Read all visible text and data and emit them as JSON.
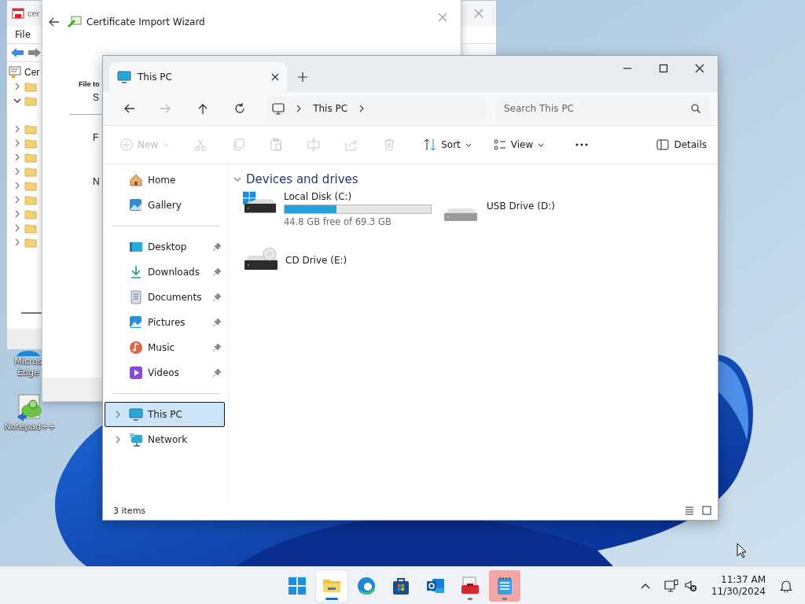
{
  "desktop_icons": [
    {
      "kind": "browser",
      "lines": [
        "Micros",
        "Edge"
      ]
    },
    {
      "kind": "notepad",
      "lines": [
        "Notepad++"
      ]
    }
  ],
  "cert_manager": {
    "title": "cer",
    "menu": [
      "File"
    ],
    "tree_root": "Cer",
    "tree": [
      {
        "expanded": false
      },
      {
        "expanded": true
      },
      {
        "expanded": false
      },
      {
        "expanded": false
      },
      {
        "expanded": false
      },
      {
        "expanded": false
      },
      {
        "expanded": false
      },
      {
        "expanded": false
      },
      {
        "expanded": false
      },
      {
        "expanded": false
      },
      {
        "expanded": false
      }
    ]
  },
  "wizard": {
    "title": "Certificate Import Wizard",
    "heading": "File to",
    "lines": [
      "S",
      "F",
      "N"
    ]
  },
  "explorer": {
    "tab": {
      "title": "This PC"
    },
    "address": {
      "crumbs": [
        "This PC"
      ]
    },
    "search": {
      "placeholder": "Search This PC"
    },
    "toolbar": [
      {
        "kind": "new",
        "label": "New",
        "disabled": true
      },
      {
        "kind": "cut",
        "disabled": true
      },
      {
        "kind": "copy",
        "disabled": true
      },
      {
        "kind": "paste",
        "disabled": true
      },
      {
        "kind": "rename",
        "disabled": true
      },
      {
        "kind": "share",
        "disabled": true
      },
      {
        "kind": "delete",
        "disabled": true
      },
      {
        "kind": "sort",
        "label": "Sort",
        "disabled": false
      },
      {
        "kind": "view",
        "label": "View",
        "disabled": false
      },
      {
        "kind": "more",
        "disabled": false
      }
    ],
    "details_button": "Details",
    "sidebar": [
      {
        "items": [
          {
            "kind": "home",
            "label": "Home",
            "selected": false,
            "pinned": false
          },
          {
            "kind": "gallery",
            "label": "Gallery",
            "selected": false,
            "pinned": false
          }
        ]
      },
      {
        "items": [
          {
            "kind": "desktop",
            "label": "Desktop",
            "selected": false,
            "pinned": true
          },
          {
            "kind": "downloads",
            "label": "Downloads",
            "selected": false,
            "pinned": true
          },
          {
            "kind": "documents",
            "label": "Documents",
            "selected": false,
            "pinned": true
          },
          {
            "kind": "pictures",
            "label": "Pictures",
            "selected": false,
            "pinned": true
          },
          {
            "kind": "music",
            "label": "Music",
            "selected": false,
            "pinned": true
          },
          {
            "kind": "videos",
            "label": "Videos",
            "selected": false,
            "pinned": true
          }
        ]
      },
      {
        "items": [
          {
            "kind": "pc",
            "label": "This PC",
            "selected": true,
            "pinned": false,
            "expanded": false
          },
          {
            "kind": "network",
            "label": "Network",
            "selected": false,
            "pinned": false,
            "expanded": false
          }
        ]
      }
    ],
    "section": {
      "title": "Devices and drives",
      "expanded": true,
      "drives": [
        {
          "kind": "system",
          "name": "Local Disk (C:)",
          "level": 0.354,
          "caption": "44.8 GB free of 69.3 GB"
        },
        {
          "kind": "usb",
          "name": "USB Drive (D:)"
        },
        {
          "kind": "cd",
          "name": "CD Drive (E:)"
        }
      ]
    },
    "status_bar": {
      "count": "3 items"
    }
  },
  "taskbar": {
    "apps": [
      {
        "kind": "start",
        "running": false,
        "active": false,
        "attention": false
      },
      {
        "kind": "folder",
        "running": true,
        "active": true,
        "attention": false
      },
      {
        "kind": "browser",
        "running": false,
        "active": false,
        "attention": false
      },
      {
        "kind": "store",
        "running": false,
        "active": false,
        "attention": false
      },
      {
        "kind": "mail",
        "running": false,
        "active": false,
        "attention": false
      },
      {
        "kind": "toolbox",
        "running": true,
        "active": false,
        "attention": false
      },
      {
        "kind": "notepad",
        "running": true,
        "active": false,
        "attention": true
      }
    ],
    "time": "11:37 AM",
    "date": "11/30/2024"
  }
}
